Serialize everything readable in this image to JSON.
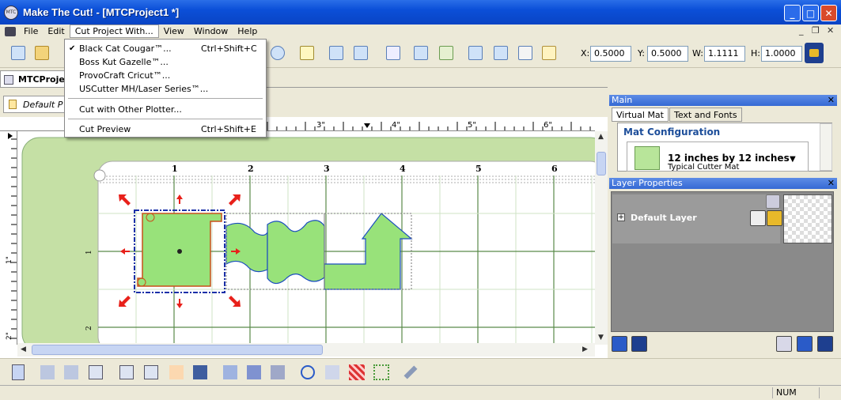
{
  "window": {
    "title": "Make The Cut! - [MTCProject1 *]",
    "minimize": "_",
    "maximize": "□",
    "close": "✕"
  },
  "menu": {
    "items": [
      "File",
      "Edit",
      "Cut Project With...",
      "View",
      "Window",
      "Help"
    ],
    "mdi": {
      "minimize": "_",
      "restore": "❐",
      "close": "✕"
    }
  },
  "dropdown": {
    "items": [
      {
        "label": "Black Cat Cougar™...",
        "shortcut": "Ctrl+Shift+C",
        "checked": "✔"
      },
      {
        "label": "Boss Kut Gazelle™...",
        "shortcut": ""
      },
      {
        "label": "ProvoCraft Cricut™...",
        "shortcut": ""
      },
      {
        "label": "USCutter MH/Laser Series™...",
        "shortcut": ""
      },
      {
        "label": "Cut with Other Plotter...",
        "shortcut": ""
      },
      {
        "label": "Cut Preview",
        "shortcut": "Ctrl+Shift+E"
      }
    ]
  },
  "coords": {
    "x_label": "X:",
    "x": "0.5000",
    "y_label": "Y:",
    "y": "0.5000",
    "w_label": "W:",
    "w": "1.1111",
    "h_label": "H:",
    "h": "1.0000"
  },
  "document_tab": "MTCProje",
  "layer_tab": "Default P",
  "ruler": {
    "top": [
      "3\"",
      "4\"",
      "5\"",
      "6\""
    ],
    "mat_top": [
      "1",
      "2",
      "3",
      "4",
      "5",
      "6"
    ],
    "left": [
      "1\"",
      "2\""
    ],
    "mat_left": [
      "1",
      "2"
    ]
  },
  "panels": {
    "main": {
      "title": "Main",
      "close": "✕",
      "tabs": [
        "Virtual Mat",
        "Text and Fonts"
      ]
    },
    "mat": {
      "header": "Mat Configuration",
      "name": "12 inches by 12 inches",
      "sub": "Typical Cutter Mat"
    },
    "layers": {
      "title": "Layer Properties",
      "close": "✕",
      "layer_name": "Default Layer",
      "expand": "+"
    }
  },
  "status": {
    "num": "NUM"
  },
  "colors": {
    "accent": "#0a44c4",
    "shape_fill": "#98e27a",
    "mat_green": "#c5e0a5",
    "handle_red": "#e8201a",
    "selection_blue": "#1a2fa8"
  }
}
